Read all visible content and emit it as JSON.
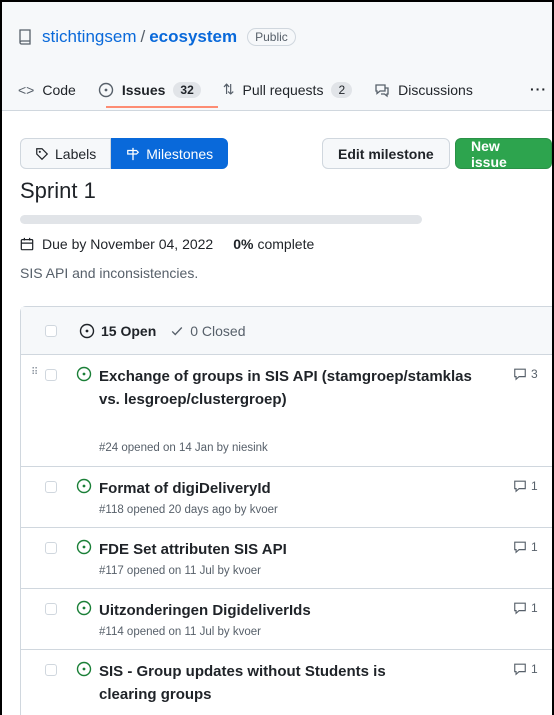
{
  "repo": {
    "owner": "stichtingsem",
    "slash": "/",
    "name": "ecosystem",
    "visibility": "Public"
  },
  "tabs": [
    {
      "label": "Code",
      "icon": "code-icon"
    },
    {
      "label": "Issues",
      "count": "32",
      "icon": "issue-icon",
      "active": true
    },
    {
      "label": "Pull requests",
      "count": "2",
      "icon": "pull-request-icon"
    },
    {
      "label": "Discussions",
      "icon": "discussion-icon"
    }
  ],
  "more": "···",
  "toolbar": {
    "labels": "Labels",
    "milestones": "Milestones",
    "edit": "Edit milestone",
    "new_issue": "New issue"
  },
  "milestone": {
    "title": "Sprint 1",
    "progress": 0,
    "due": "Due by November 04, 2022",
    "pct": "0%",
    "pct_label": "complete",
    "description": "SIS API and inconsistencies."
  },
  "list": {
    "open": "15 Open",
    "closed": "0 Closed"
  },
  "issues": [
    {
      "title": "Exchange of groups in SIS API (stamgroep/stamklas vs. lesgroep/clustergroep)",
      "meta": "#24 opened on 14 Jan by niesink",
      "comments": "3"
    },
    {
      "title": "Format of digiDeliveryId",
      "meta": "#118 opened 20 days ago by kvoer",
      "comments": "1"
    },
    {
      "title": "FDE Set attributen SIS API",
      "meta": "#117 opened on 11 Jul by kvoer",
      "comments": "1"
    },
    {
      "title": "Uitzonderingen DigideliverIds",
      "meta": "#114 opened on 11 Jul by kvoer",
      "comments": "1"
    },
    {
      "title": "SIS - Group updates without Students is clearing groups",
      "meta": "",
      "comments": "1"
    }
  ],
  "colors": {
    "accent": "#0969da",
    "success": "#2da44e",
    "open_icon": "#1a7f37"
  }
}
